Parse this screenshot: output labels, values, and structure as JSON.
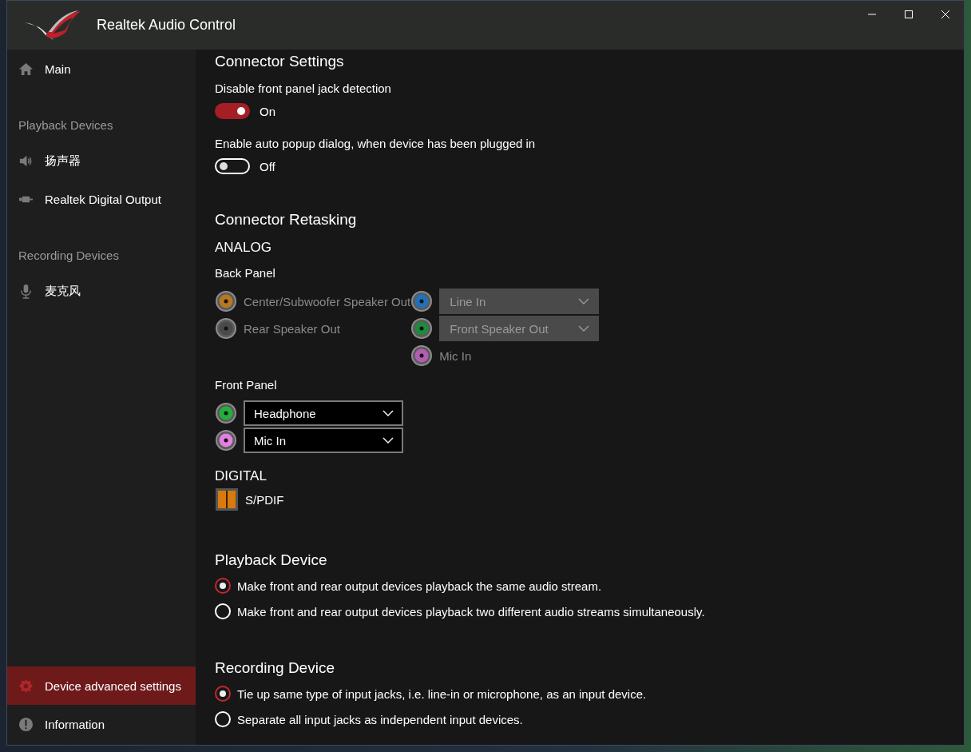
{
  "window": {
    "title": "Realtek Audio Control"
  },
  "sidebar": {
    "items": [
      {
        "kind": "home",
        "label": "Main",
        "selected": false
      },
      {
        "kind": "heading",
        "label": "Playback Devices"
      },
      {
        "kind": "speaker",
        "label": "扬声器",
        "selected": false
      },
      {
        "kind": "digital",
        "label": "Realtek Digital Output",
        "selected": false
      },
      {
        "kind": "heading",
        "label": "Recording Devices"
      },
      {
        "kind": "mic",
        "label": "麦克风",
        "selected": false
      }
    ],
    "bottom_items": [
      {
        "kind": "gear",
        "label": "Device advanced settings",
        "selected": true
      },
      {
        "kind": "info",
        "label": "Information",
        "selected": false
      }
    ]
  },
  "connector_settings": {
    "title": "Connector Settings",
    "toggles": [
      {
        "label": "Disable front panel jack detection",
        "on": true,
        "state_text": "On"
      },
      {
        "label": "Enable auto popup dialog, when device has been plugged in",
        "on": false,
        "state_text": "Off"
      }
    ]
  },
  "connector_retasking": {
    "title": "Connector Retasking",
    "analog_label": "ANALOG",
    "back_panel": {
      "label": "Back Panel",
      "left_jacks": [
        {
          "color": "#b7781f",
          "label": "Center/Subwoofer Speaker Out",
          "disabled": true
        },
        {
          "color": "#4a4a4a",
          "label": "Rear Speaker Out",
          "disabled": true
        }
      ],
      "right_jacks": [
        {
          "kind": "dropdown",
          "color": "#1f72b8",
          "value": "Line In",
          "disabled": true
        },
        {
          "kind": "dropdown",
          "color": "#1d8a3c",
          "value": "Front Speaker Out",
          "disabled": true
        },
        {
          "kind": "label",
          "color": "#b25cb4",
          "value": "Mic In",
          "disabled": true
        }
      ]
    },
    "front_panel": {
      "label": "Front Panel",
      "jacks": [
        {
          "kind": "dropdown",
          "color": "#22b03a",
          "value": "Headphone",
          "disabled": false
        },
        {
          "kind": "dropdown",
          "color": "#e27fe0",
          "value": "Mic In",
          "disabled": false
        }
      ]
    },
    "digital_label": "DIGITAL",
    "digital": {
      "label": "S/PDIF"
    }
  },
  "playback_device": {
    "title": "Playback Device",
    "options": [
      {
        "label": "Make front and rear output devices playback the same audio stream.",
        "selected": true
      },
      {
        "label": "Make front and rear output devices playback two different audio streams simultaneously.",
        "selected": false
      }
    ]
  },
  "recording_device": {
    "title": "Recording Device",
    "options": [
      {
        "label": "Tie up same type of input jacks, i.e. line-in or microphone, as an input device.",
        "selected": true
      },
      {
        "label": "Separate all input jacks as independent input devices.",
        "selected": false
      }
    ]
  }
}
